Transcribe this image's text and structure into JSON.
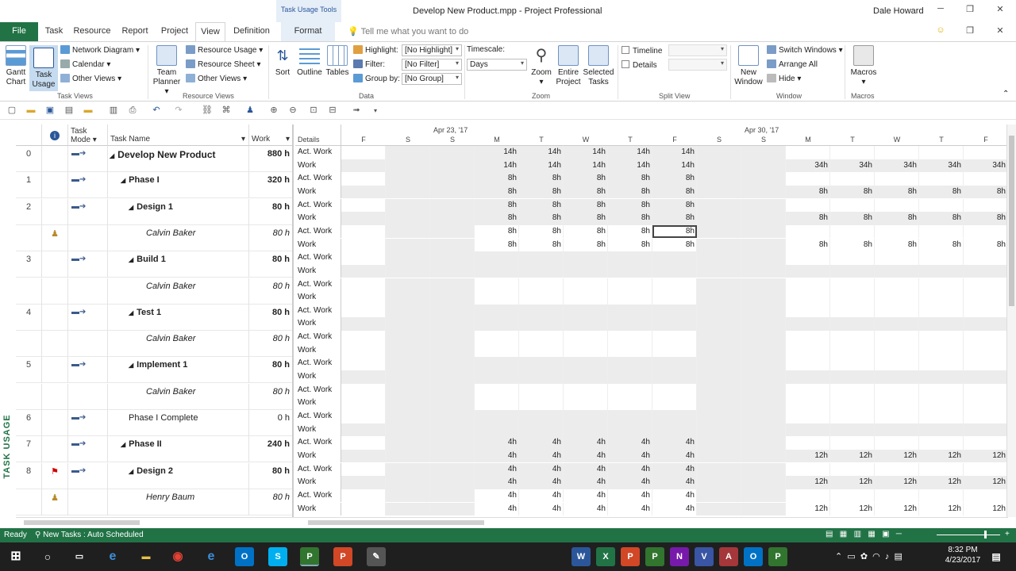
{
  "titlebar": {
    "tools_tab": "Task Usage Tools",
    "doc_title": "Develop New Product.mpp - Project Professional",
    "user": "Dale Howard"
  },
  "tabs": [
    "File",
    "Task",
    "Resource",
    "Report",
    "Project",
    "View",
    "Definition",
    "Format"
  ],
  "active_tab": "View",
  "tell_me": "Tell me what you want to do",
  "ribbon": {
    "task_views": {
      "label": "Task Views",
      "gantt": "Gantt Chart",
      "task_usage": "Task Usage",
      "network": "Network Diagram",
      "calendar": "Calendar",
      "other": "Other Views"
    },
    "resource_views": {
      "label": "Resource Views",
      "team": "Team Planner",
      "usage": "Resource Usage",
      "sheet": "Resource Sheet",
      "other": "Other Views"
    },
    "data": {
      "label": "Data",
      "sort": "Sort",
      "outline": "Outline",
      "tables": "Tables",
      "highlight_label": "Highlight:",
      "highlight_val": "[No Highlight]",
      "filter_label": "Filter:",
      "filter_val": "[No Filter]",
      "group_label": "Group by:",
      "group_val": "[No Group]"
    },
    "zoom": {
      "label": "Zoom",
      "timescale": "Timescale:",
      "timescale_val": "Days",
      "zoom": "Zoom",
      "entire": "Entire Project",
      "selected": "Selected Tasks"
    },
    "split": {
      "label": "Split View",
      "timeline": "Timeline",
      "details": "Details"
    },
    "window": {
      "label": "Window",
      "new": "New Window",
      "switch": "Switch Windows",
      "arrange": "Arrange All",
      "hide": "Hide"
    },
    "macros": {
      "label": "Macros",
      "macros": "Macros"
    }
  },
  "view_name": "TASK USAGE",
  "table_headers": {
    "mode": "Task Mode",
    "name": "Task Name",
    "work": "Work",
    "details": "Details"
  },
  "weeks": [
    "Apr 23, '17",
    "Apr 30, '17"
  ],
  "days": [
    "F",
    "S",
    "S",
    "M",
    "T",
    "W",
    "T",
    "F",
    "S",
    "S",
    "M",
    "T",
    "W",
    "T",
    "F"
  ],
  "rows": [
    {
      "id": "0",
      "name": "Develop New Product",
      "work": "880 h",
      "level": 0,
      "type": "summary",
      "ind": "",
      "act": [
        "",
        "",
        "",
        "14h",
        "14h",
        "14h",
        "14h",
        "14h",
        "",
        "",
        "",
        "",
        "",
        "",
        ""
      ],
      "wrk": [
        "",
        "",
        "",
        "14h",
        "14h",
        "14h",
        "14h",
        "14h",
        "",
        "",
        "34h",
        "34h",
        "34h",
        "34h",
        "34h"
      ]
    },
    {
      "id": "1",
      "name": "Phase I",
      "work": "320 h",
      "level": 1,
      "type": "summary",
      "ind": "",
      "act": [
        "",
        "",
        "",
        "8h",
        "8h",
        "8h",
        "8h",
        "8h",
        "",
        "",
        "",
        "",
        "",
        "",
        ""
      ],
      "wrk": [
        "",
        "",
        "",
        "8h",
        "8h",
        "8h",
        "8h",
        "8h",
        "",
        "",
        "8h",
        "8h",
        "8h",
        "8h",
        "8h"
      ]
    },
    {
      "id": "2",
      "name": "Design 1",
      "work": "80 h",
      "level": 2,
      "type": "summary",
      "ind": "",
      "act": [
        "",
        "",
        "",
        "8h",
        "8h",
        "8h",
        "8h",
        "8h",
        "",
        "",
        "",
        "",
        "",
        "",
        ""
      ],
      "wrk": [
        "",
        "",
        "",
        "8h",
        "8h",
        "8h",
        "8h",
        "8h",
        "",
        "",
        "8h",
        "8h",
        "8h",
        "8h",
        "8h"
      ]
    },
    {
      "id": "",
      "name": "Calvin Baker",
      "work": "80 h",
      "level": 3,
      "type": "assignment",
      "ind": "assign",
      "act": [
        "",
        "",
        "",
        "8h",
        "8h",
        "8h",
        "8h",
        "8h",
        "",
        "",
        "",
        "",
        "",
        "",
        ""
      ],
      "wrk": [
        "",
        "",
        "",
        "8h",
        "8h",
        "8h",
        "8h",
        "8h",
        "",
        "",
        "8h",
        "8h",
        "8h",
        "8h",
        "8h"
      ]
    },
    {
      "id": "3",
      "name": "Build 1",
      "work": "80 h",
      "level": 2,
      "type": "summary",
      "ind": "",
      "act": [
        "",
        "",
        "",
        "",
        "",
        "",
        "",
        "",
        "",
        "",
        "",
        "",
        "",
        "",
        ""
      ],
      "wrk": [
        "",
        "",
        "",
        "",
        "",
        "",
        "",
        "",
        "",
        "",
        "",
        "",
        "",
        "",
        ""
      ]
    },
    {
      "id": "",
      "name": "Calvin Baker",
      "work": "80 h",
      "level": 3,
      "type": "assignment",
      "ind": "",
      "act": [
        "",
        "",
        "",
        "",
        "",
        "",
        "",
        "",
        "",
        "",
        "",
        "",
        "",
        "",
        ""
      ],
      "wrk": [
        "",
        "",
        "",
        "",
        "",
        "",
        "",
        "",
        "",
        "",
        "",
        "",
        "",
        "",
        ""
      ]
    },
    {
      "id": "4",
      "name": "Test 1",
      "work": "80 h",
      "level": 2,
      "type": "summary",
      "ind": "",
      "act": [
        "",
        "",
        "",
        "",
        "",
        "",
        "",
        "",
        "",
        "",
        "",
        "",
        "",
        "",
        ""
      ],
      "wrk": [
        "",
        "",
        "",
        "",
        "",
        "",
        "",
        "",
        "",
        "",
        "",
        "",
        "",
        "",
        ""
      ]
    },
    {
      "id": "",
      "name": "Calvin Baker",
      "work": "80 h",
      "level": 3,
      "type": "assignment",
      "ind": "",
      "act": [
        "",
        "",
        "",
        "",
        "",
        "",
        "",
        "",
        "",
        "",
        "",
        "",
        "",
        "",
        ""
      ],
      "wrk": [
        "",
        "",
        "",
        "",
        "",
        "",
        "",
        "",
        "",
        "",
        "",
        "",
        "",
        "",
        ""
      ]
    },
    {
      "id": "5",
      "name": "Implement 1",
      "work": "80 h",
      "level": 2,
      "type": "summary",
      "ind": "",
      "act": [
        "",
        "",
        "",
        "",
        "",
        "",
        "",
        "",
        "",
        "",
        "",
        "",
        "",
        "",
        ""
      ],
      "wrk": [
        "",
        "",
        "",
        "",
        "",
        "",
        "",
        "",
        "",
        "",
        "",
        "",
        "",
        "",
        ""
      ]
    },
    {
      "id": "",
      "name": "Calvin Baker",
      "work": "80 h",
      "level": 3,
      "type": "assignment",
      "ind": "",
      "act": [
        "",
        "",
        "",
        "",
        "",
        "",
        "",
        "",
        "",
        "",
        "",
        "",
        "",
        "",
        ""
      ],
      "wrk": [
        "",
        "",
        "",
        "",
        "",
        "",
        "",
        "",
        "",
        "",
        "",
        "",
        "",
        "",
        ""
      ]
    },
    {
      "id": "6",
      "name": "Phase I Complete",
      "work": "0 h",
      "level": 2,
      "type": "task",
      "ind": "",
      "act": [
        "",
        "",
        "",
        "",
        "",
        "",
        "",
        "",
        "",
        "",
        "",
        "",
        "",
        "",
        ""
      ],
      "wrk": [
        "",
        "",
        "",
        "",
        "",
        "",
        "",
        "",
        "",
        "",
        "",
        "",
        "",
        "",
        ""
      ]
    },
    {
      "id": "7",
      "name": "Phase II",
      "work": "240 h",
      "level": 1,
      "type": "summary",
      "ind": "",
      "act": [
        "",
        "",
        "",
        "4h",
        "4h",
        "4h",
        "4h",
        "4h",
        "",
        "",
        "",
        "",
        "",
        "",
        ""
      ],
      "wrk": [
        "",
        "",
        "",
        "4h",
        "4h",
        "4h",
        "4h",
        "4h",
        "",
        "",
        "12h",
        "12h",
        "12h",
        "12h",
        "12h"
      ]
    },
    {
      "id": "8",
      "name": "Design 2",
      "work": "80 h",
      "level": 2,
      "type": "summary",
      "ind": "flag",
      "act": [
        "",
        "",
        "",
        "4h",
        "4h",
        "4h",
        "4h",
        "4h",
        "",
        "",
        "",
        "",
        "",
        "",
        ""
      ],
      "wrk": [
        "",
        "",
        "",
        "4h",
        "4h",
        "4h",
        "4h",
        "4h",
        "",
        "",
        "12h",
        "12h",
        "12h",
        "12h",
        "12h"
      ]
    },
    {
      "id": "",
      "name": "Henry Baum",
      "work": "80 h",
      "level": 3,
      "type": "assignment",
      "ind": "assign",
      "act": [
        "",
        "",
        "",
        "4h",
        "4h",
        "4h",
        "4h",
        "4h",
        "",
        "",
        "",
        "",
        "",
        "",
        ""
      ],
      "wrk": [
        "",
        "",
        "",
        "4h",
        "4h",
        "4h",
        "4h",
        "4h",
        "",
        "",
        "12h",
        "12h",
        "12h",
        "12h",
        "12h"
      ]
    }
  ],
  "detail_labels": {
    "act": "Act. Work",
    "work": "Work"
  },
  "status": {
    "ready": "Ready",
    "new_tasks": "New Tasks : Auto Scheduled"
  },
  "clock": {
    "time": "8:32 PM",
    "date": "4/23/2017"
  },
  "colors": {
    "accent": "#217346",
    "ribbon_blue": "#2b579a"
  }
}
